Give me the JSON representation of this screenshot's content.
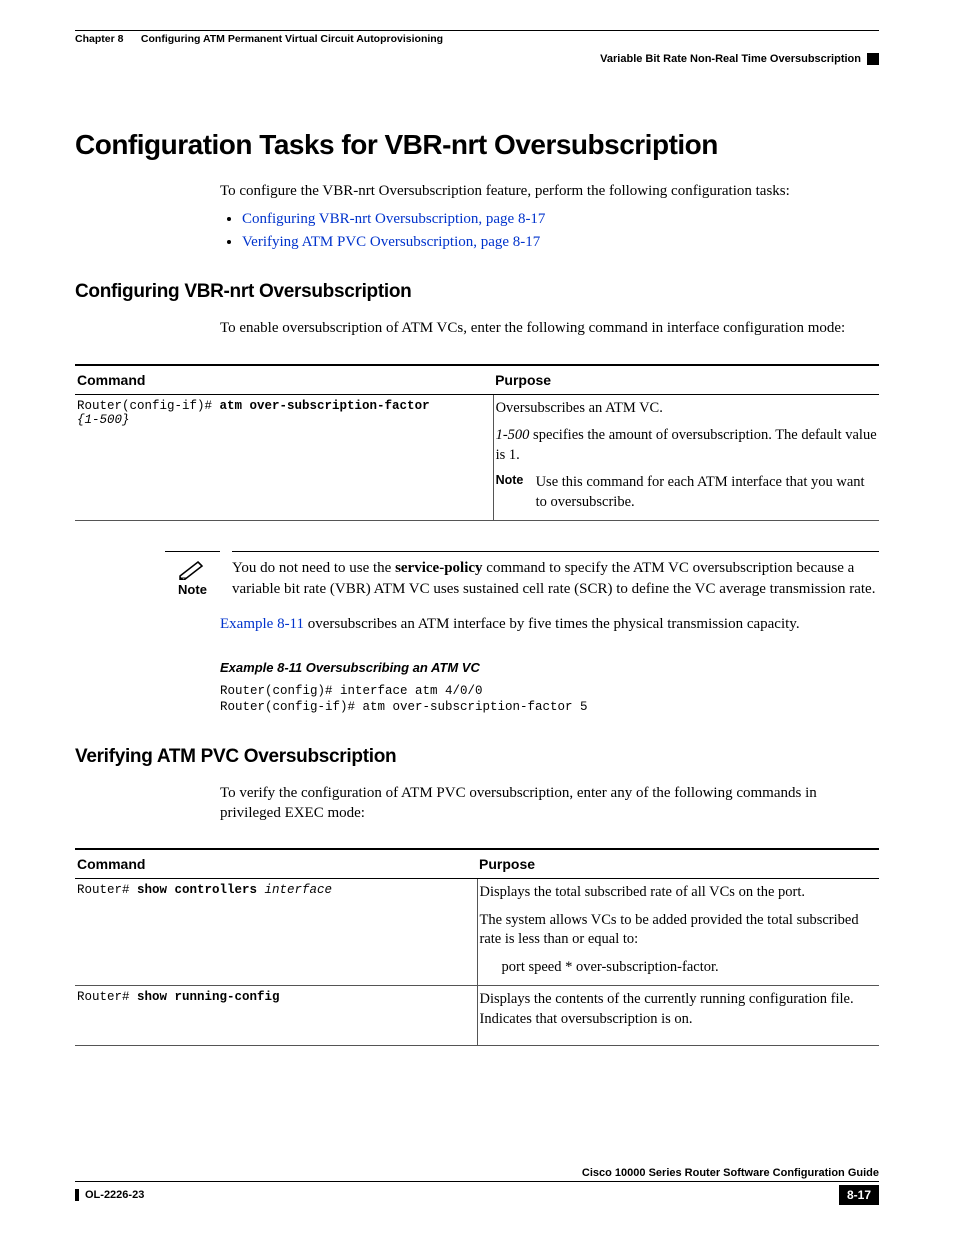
{
  "header": {
    "chapter_label": "Chapter 8      Configuring ATM Permanent Virtual Circuit Autoprovisioning",
    "section_label": "Variable Bit Rate Non-Real Time Oversubscription"
  },
  "h1": "Configuration Tasks for VBR-nrt Oversubscription",
  "intro": "To configure the VBR-nrt Oversubscription feature, perform the following configuration tasks:",
  "links": [
    "Configuring VBR-nrt Oversubscription, page 8-17",
    "Verifying ATM PVC Oversubscription, page 8-17"
  ],
  "sec1": {
    "title": "Configuring VBR-nrt Oversubscription",
    "intro": "To enable oversubscription of ATM VCs, enter the following command in interface configuration mode:",
    "table": {
      "h_command": "Command",
      "h_purpose": "Purpose",
      "cmd_prompt": "Router(config-if)# ",
      "cmd_bold": "atm over-subscription-factor",
      "cmd_arg": "{1-500}",
      "p1": "Oversubscribes an ATM VC.",
      "p2_ital": "1-500",
      "p2_rest": " specifies the amount of oversubscription. The default value is 1.",
      "note_label": "Note",
      "note_text": "Use this command for each ATM interface that you want to oversubscribe."
    },
    "note": {
      "label": "Note",
      "text_pre": "You do not need to use the ",
      "text_bold": "service-policy",
      "text_post": " command to specify the ATM VC oversubscription because a variable bit rate (VBR) ATM VC uses sustained cell rate (SCR) to define the VC average transmission rate."
    },
    "example_ref_link": "Example 8-11",
    "example_ref_rest": " oversubscribes an ATM interface by five times the physical transmission capacity.",
    "example_title": "Example 8-11   Oversubscribing an ATM VC",
    "example_code": "Router(config)# interface atm 4/0/0\nRouter(config-if)# atm over-subscription-factor 5"
  },
  "sec2": {
    "title": "Verifying ATM PVC Oversubscription",
    "intro": "To verify the configuration of ATM PVC oversubscription, enter any of the following commands in privileged EXEC mode:",
    "table": {
      "h_command": "Command",
      "h_purpose": "Purpose",
      "r1_prompt": "Router# ",
      "r1_bold": "show controllers ",
      "r1_ital": "interface",
      "r1_p1": "Displays the total subscribed rate of all VCs on the port.",
      "r1_p2": "The system allows VCs to be added provided the total subscribed rate is less than or equal to:",
      "r1_p3": "port speed * over-subscription-factor.",
      "r2_prompt": "Router# ",
      "r2_bold": "show running-config",
      "r2_p": "Displays the contents of the currently running configuration file. Indicates that oversubscription is on."
    }
  },
  "footer": {
    "guide": "Cisco 10000 Series Router Software Configuration Guide",
    "docnum": "OL-2226-23",
    "pagenum": "8-17"
  }
}
